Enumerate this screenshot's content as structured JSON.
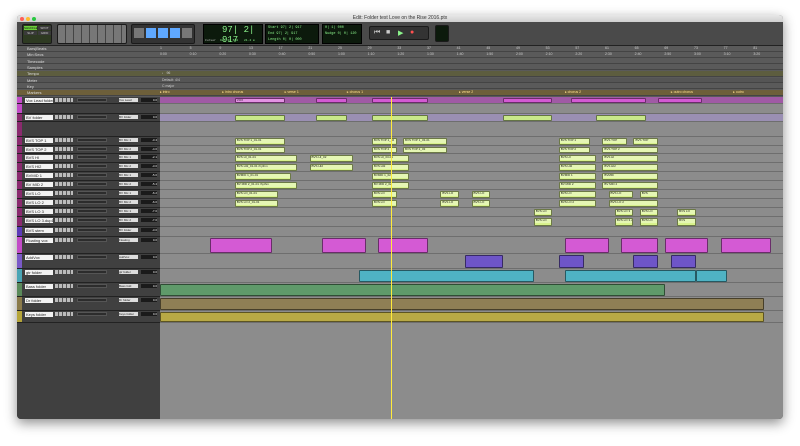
{
  "window": {
    "title": "Edit: Folder test Love on the Rise 2016.ptx"
  },
  "toolbar": {
    "modes": [
      "SHUFFLE",
      "SPOT",
      "SLIP",
      "GRID"
    ],
    "counter_main": "97| 2| 917",
    "counter_label": "Cursor",
    "cursor_value": "98| 3| 520",
    "start_label": "Start",
    "end_label": "End",
    "length_label": "Length",
    "start_value": "97| 2| 917",
    "end_value": "97| 2| 917",
    "length_value": "0| 0| 000",
    "nudge_label": "Nudge",
    "grid_value": "0| 1| 000",
    "nudge_value": "0| 0| 120",
    "counter_tiny": "21.4 m"
  },
  "rulers": {
    "labels": [
      "Bars|Beats",
      "Min:Secs",
      "Timecode",
      "Samples",
      "Tempo",
      "Meter",
      "Key",
      "Markers"
    ],
    "bars": [
      "1",
      "5",
      "9",
      "13",
      "17",
      "21",
      "25",
      "29",
      "33",
      "37",
      "41",
      "45",
      "49",
      "53",
      "57",
      "61",
      "65",
      "69",
      "73",
      "77",
      "81"
    ],
    "minsecs": [
      "0:00",
      "0:10",
      "0:20",
      "0:30",
      "0:40",
      "0:50",
      "1:00",
      "1:10",
      "1:20",
      "1:30",
      "1:40",
      "1:50",
      "2:00",
      "2:10",
      "2:20",
      "2:30",
      "2:40",
      "2:50",
      "3:00",
      "3:10",
      "3:20"
    ],
    "tempo_value": "♩ 96",
    "meter_value": "Default: 4/4",
    "key_value": "C major",
    "markers": [
      {
        "label": "intro",
        "pos": 0.0
      },
      {
        "label": "intro chorus",
        "pos": 0.1
      },
      {
        "label": "verse 1",
        "pos": 0.2
      },
      {
        "label": "chorus 1",
        "pos": 0.3
      },
      {
        "label": "verse 2",
        "pos": 0.48
      },
      {
        "label": "chorus 2",
        "pos": 0.65
      },
      {
        "label": "outro chorus",
        "pos": 0.82
      },
      {
        "label": "outro",
        "pos": 0.92
      }
    ]
  },
  "tracks": [
    {
      "name": "Vox Lead folder",
      "color": "#c24bc7",
      "h": 7,
      "io": "Vox Lead",
      "vol": "0.0",
      "lane": "#a05aa5",
      "clips": [
        [
          0.12,
          0.2,
          "VOX"
        ],
        [
          0.25,
          0.3,
          ""
        ],
        [
          0.34,
          0.43,
          ""
        ],
        [
          0.55,
          0.63,
          ""
        ],
        [
          0.66,
          0.78,
          ""
        ],
        [
          0.8,
          0.87,
          ""
        ]
      ]
    },
    {
      "name": "",
      "color": "#c24bc7",
      "h": 10,
      "io": "",
      "vol": "",
      "lane": "#8c8c8c",
      "clips": []
    },
    {
      "name": "BV folder",
      "color": "#8a2a6e",
      "h": 8,
      "io": "BV folder",
      "vol": "0.0",
      "lane": "#9a8fb3",
      "clips": [
        [
          0.12,
          0.2,
          ""
        ],
        [
          0.25,
          0.3,
          ""
        ],
        [
          0.34,
          0.43,
          ""
        ],
        [
          0.55,
          0.63,
          ""
        ],
        [
          0.7,
          0.78,
          ""
        ]
      ]
    },
    {
      "name": "",
      "color": "#8a2a6e",
      "h": 15,
      "io": "",
      "vol": "",
      "lane": "#8c8c8c",
      "clips": []
    },
    {
      "name": "BVS TOP 1",
      "color": "#8a2a6e",
      "h": 9,
      "io": "BV Mic 1",
      "vol": "-3.4",
      "lane": "#8c8c8c",
      "clips": [
        [
          0.12,
          0.2,
          "BVS TOP 1_01-01"
        ],
        [
          0.34,
          0.38,
          "BVS TOP 1_02"
        ],
        [
          0.39,
          0.46,
          "BVS TOP 1_03-01"
        ],
        [
          0.64,
          0.69,
          "BVS TOP 1"
        ],
        [
          0.71,
          0.75,
          "BVS TOP"
        ],
        [
          0.76,
          0.8,
          "BVS TOP"
        ]
      ]
    },
    {
      "name": "BVS TOP 2",
      "color": "#8a2a6e",
      "h": 8,
      "io": "BV Mic 2",
      "vol": "-4.0",
      "lane": "#8c8c8c",
      "clips": [
        [
          0.12,
          0.2,
          "BVS TOP 2_01-01"
        ],
        [
          0.34,
          0.38,
          "BVS TOP 2"
        ],
        [
          0.39,
          0.46,
          "BVS TOP 2_03"
        ],
        [
          0.64,
          0.69,
          "BVS TOP 2"
        ],
        [
          0.71,
          0.8,
          "BVS TOP 2"
        ]
      ]
    },
    {
      "name": "BVS HI",
      "color": "#8a2a6e",
      "h": 9,
      "io": "BV Mic 1",
      "vol": "-2.1",
      "lane": "#8c8c8c",
      "clips": [
        [
          0.12,
          0.22,
          "BVS HI_01-01"
        ],
        [
          0.24,
          0.31,
          "BVS HI_02"
        ],
        [
          0.34,
          0.4,
          "BVS HI_03-01"
        ],
        [
          0.64,
          0.7,
          "BVS HI"
        ],
        [
          0.71,
          0.8,
          "BVS HI"
        ]
      ]
    },
    {
      "name": "BVS HI2",
      "color": "#8a2a6e",
      "h": 9,
      "io": "BV Mic 2",
      "vol": "-3.0",
      "lane": "#8c8c8c",
      "clips": [
        [
          0.12,
          0.22,
          "BVS HI2_01-01 rhythm"
        ],
        [
          0.24,
          0.31,
          "BVS HI2"
        ],
        [
          0.34,
          0.4,
          "BVS HI2"
        ],
        [
          0.64,
          0.7,
          "BVS HI2"
        ],
        [
          0.71,
          0.8,
          "BVS HI2"
        ]
      ]
    },
    {
      "name": "BVMID 1",
      "color": "#8a2a6e",
      "h": 9,
      "io": "BV Mic 1",
      "vol": "-5.0",
      "lane": "#8c8c8c",
      "clips": [
        [
          0.12,
          0.21,
          "BVMID 1_01-01"
        ],
        [
          0.34,
          0.4,
          "BVMID 1_02"
        ],
        [
          0.64,
          0.7,
          "BVMID 1"
        ],
        [
          0.71,
          0.8,
          "BVMID"
        ]
      ]
    },
    {
      "name": "BV MID 2",
      "color": "#8a2a6e",
      "h": 9,
      "io": "BV Mic 2",
      "vol": "-5.4",
      "lane": "#8c8c8c",
      "clips": [
        [
          0.12,
          0.22,
          "BV MID 2_01-01 rhythm"
        ],
        [
          0.34,
          0.4,
          "BV MID 2_02"
        ],
        [
          0.64,
          0.7,
          "BV MID 2"
        ],
        [
          0.71,
          0.8,
          "BV MID 2"
        ]
      ]
    },
    {
      "name": "BVS LO",
      "color": "#8a2a6e",
      "h": 9,
      "io": "BV Mic 1",
      "vol": "-6.2",
      "lane": "#8c8c8c",
      "clips": [
        [
          0.12,
          0.19,
          "BVS LO_01-01"
        ],
        [
          0.34,
          0.38,
          "BVS LO"
        ],
        [
          0.45,
          0.48,
          "BVS LO"
        ],
        [
          0.5,
          0.53,
          "BVS LO"
        ],
        [
          0.64,
          0.7,
          "BVS LO"
        ],
        [
          0.72,
          0.76,
          "BVS LO"
        ],
        [
          0.77,
          0.8,
          "BVS"
        ]
      ]
    },
    {
      "name": "BVS LO 2",
      "color": "#8a2a6e",
      "h": 9,
      "io": "BV Mic 2",
      "vol": "-6.0",
      "lane": "#8c8c8c",
      "clips": [
        [
          0.12,
          0.19,
          "BVS LO 2_01-01"
        ],
        [
          0.34,
          0.38,
          "BVS LO"
        ],
        [
          0.45,
          0.48,
          "BVS LO"
        ],
        [
          0.5,
          0.53,
          "BVS LO"
        ],
        [
          0.64,
          0.7,
          "BVS LO 2"
        ],
        [
          0.72,
          0.8,
          "BVS LO 2"
        ]
      ]
    },
    {
      "name": "BVS LO 3",
      "color": "#8a2a6e",
      "h": 9,
      "io": "BV Mic 1",
      "vol": "-7.0",
      "lane": "#8c8c8c",
      "clips": [
        [
          0.6,
          0.63,
          "BVS LO"
        ],
        [
          0.73,
          0.76,
          "BVS LO 3"
        ],
        [
          0.77,
          0.8,
          "BVS LO"
        ],
        [
          0.83,
          0.86,
          "BVS LO"
        ]
      ]
    },
    {
      "name": "BVS LO 3.dup1",
      "color": "#8a2a6e",
      "h": 10,
      "io": "BV Mic 2",
      "vol": "-7.0",
      "lane": "#8c8c8c",
      "clips": [
        [
          0.6,
          0.63,
          "BVS LO"
        ],
        [
          0.73,
          0.76,
          "BVS LO 3.dup1"
        ],
        [
          0.77,
          0.8,
          "BVS LO"
        ],
        [
          0.83,
          0.86,
          "BVS"
        ]
      ]
    },
    {
      "name": "BVS stem",
      "color": "#5b3ab8",
      "h": 10,
      "io": "BV folder",
      "vol": "-3.0",
      "lane": "#8c8c8c",
      "clips": []
    },
    {
      "name": "Floating vox",
      "color": "#c24bc7",
      "h": 17,
      "io": "Floating",
      "vol": "0.0",
      "lane": "#8c8c8c",
      "clips": [
        [
          0.08,
          0.18,
          ""
        ],
        [
          0.26,
          0.33,
          ""
        ],
        [
          0.35,
          0.43,
          ""
        ],
        [
          0.65,
          0.72,
          ""
        ],
        [
          0.74,
          0.8,
          ""
        ],
        [
          0.81,
          0.88,
          ""
        ],
        [
          0.9,
          0.98,
          ""
        ]
      ]
    },
    {
      "name": "AddVox",
      "color": "#7a5ac8",
      "h": 15,
      "io": "AddVox",
      "vol": "0.0",
      "lane": "#8c8c8c",
      "clips": [
        [
          0.49,
          0.55,
          ""
        ],
        [
          0.64,
          0.68,
          ""
        ],
        [
          0.76,
          0.8,
          ""
        ],
        [
          0.82,
          0.86,
          ""
        ]
      ]
    },
    {
      "name": "gtr folder",
      "color": "#4aa5b5",
      "h": 14,
      "io": "gtr folder",
      "vol": "0.0",
      "lane": "#8c8c8c",
      "clips": [
        [
          0.32,
          0.6,
          ""
        ],
        [
          0.65,
          0.86,
          ""
        ],
        [
          0.86,
          0.91,
          ""
        ]
      ]
    },
    {
      "name": "Bass folder",
      "color": "#5a8a5a",
      "h": 14,
      "io": "Bass fold",
      "vol": "0.0",
      "lane": "#8c8c8c",
      "clips": [
        [
          0.0,
          0.81,
          ""
        ]
      ]
    },
    {
      "name": "Dr folder",
      "color": "#8a7a4a",
      "h": 14,
      "io": "Dr folder",
      "vol": "0.0",
      "lane": "#8c8c8c",
      "clips": [
        [
          0.0,
          0.97,
          ""
        ]
      ]
    },
    {
      "name": "Keys folder",
      "color": "#b5a53a",
      "h": 12,
      "io": "Keys folder",
      "vol": "0.0",
      "lane": "#8c8c8c",
      "clips": [
        [
          0.0,
          0.97,
          ""
        ]
      ]
    }
  ],
  "colors": {
    "accent": "#5fa8ff",
    "clip_bv": "#d8f28c",
    "vox": "#d45ad4",
    "addvox": "#6e55c8",
    "gtr": "#4fb3c4",
    "bass": "#5f9a6a",
    "drums": "#8f7f55",
    "keys": "#b8a945"
  }
}
